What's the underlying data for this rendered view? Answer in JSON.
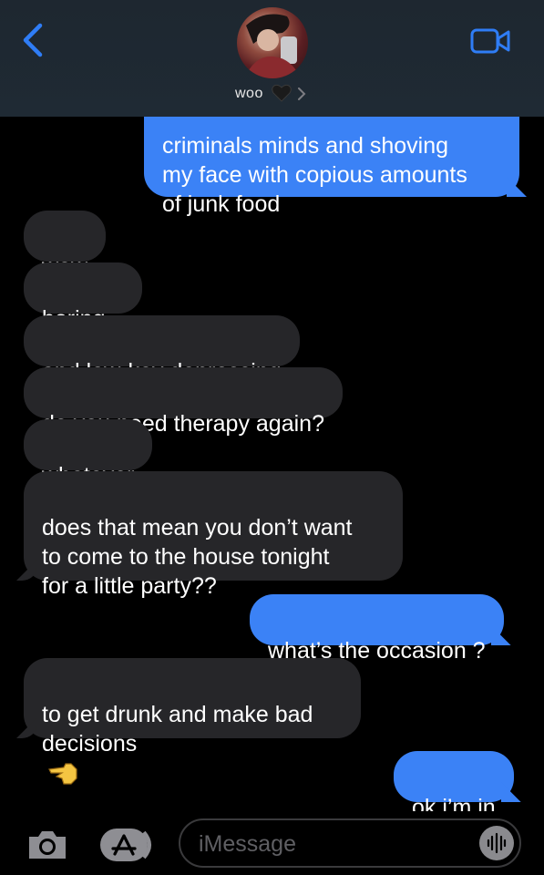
{
  "header": {
    "contact_name": "woo",
    "avatar_alt": "contact photo"
  },
  "messages": [
    {
      "side": "out",
      "text": "criminals minds and shoving\nmy face with copious amounts\nof junk food"
    },
    {
      "side": "in",
      "text": "wow"
    },
    {
      "side": "in",
      "text": "boring..."
    },
    {
      "side": "in",
      "text": "and low-key depressing"
    },
    {
      "side": "in",
      "text": "do you need therapy again?"
    },
    {
      "side": "in",
      "text": "whatever"
    },
    {
      "side": "in",
      "text": "does that mean you don’t want\nto come to the house tonight\nfor a little party??"
    },
    {
      "side": "out",
      "text": "what’s the occasion ?"
    },
    {
      "side": "in",
      "text": "to get drunk and make bad\ndecisions"
    },
    {
      "side": "out",
      "text": "ok i’m in"
    }
  ],
  "composer": {
    "placeholder": "iMessage"
  },
  "colors": {
    "outgoing": "#3b82f6",
    "incoming": "#262629",
    "accent": "#2f7df6"
  },
  "icons": [
    "back-chevron-icon",
    "video-call-icon",
    "black-heart-icon",
    "chevron-right-icon",
    "camera-icon",
    "app-store-icon",
    "audio-waveform-icon",
    "pointing-hand-emoji"
  ]
}
